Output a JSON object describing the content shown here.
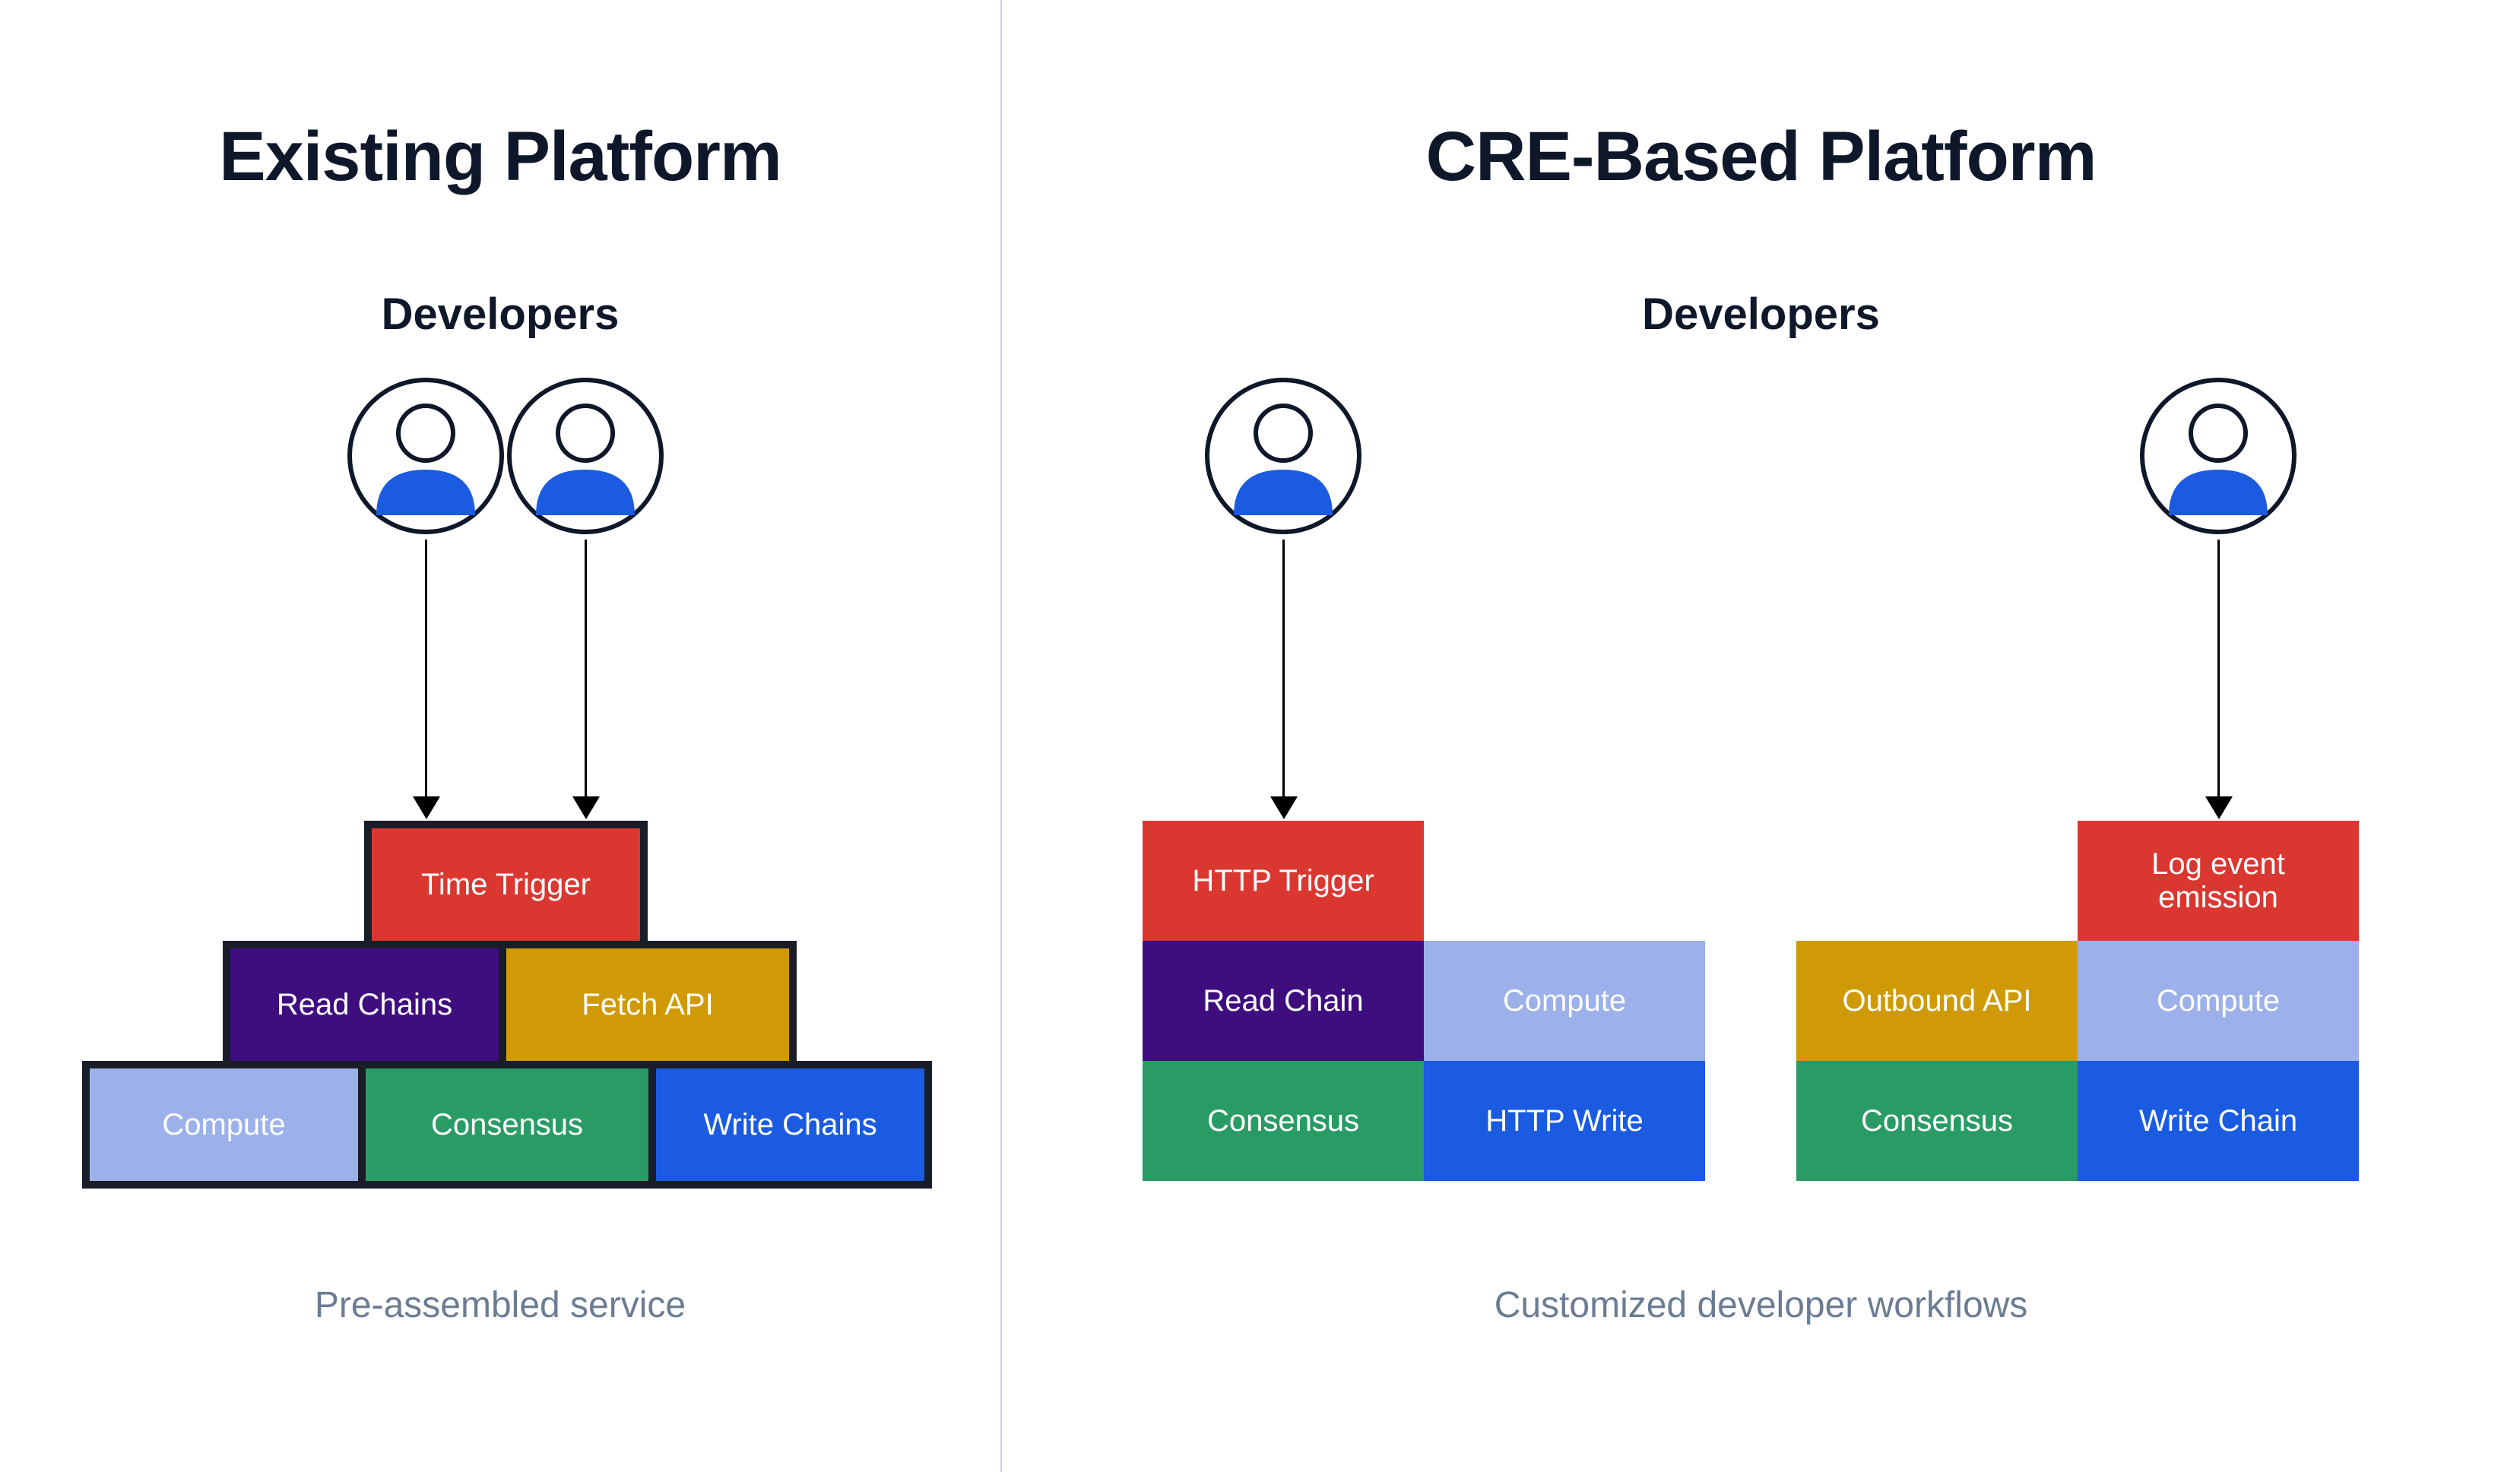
{
  "left": {
    "title": "Existing Platform",
    "subtitle": "Developers",
    "caption": "Pre-assembled service",
    "blocks": {
      "time_trigger": "Time Trigger",
      "read_chains": "Read Chains",
      "fetch_api": "Fetch API",
      "compute": "Compute",
      "consensus": "Consensus",
      "write_chains": "Write Chains"
    }
  },
  "right": {
    "title": "CRE-Based Platform",
    "subtitle": "Developers",
    "caption": "Customized developer workflows",
    "stack_a": {
      "http_trigger": "HTTP Trigger",
      "read_chain": "Read Chain",
      "compute": "Compute",
      "consensus": "Consensus",
      "http_write": "HTTP Write"
    },
    "stack_b": {
      "log_event": "Log event\nemission",
      "outbound_api": "Outbound API",
      "compute": "Compute",
      "consensus": "Consensus",
      "write_chain": "Write Chain"
    }
  },
  "colors": {
    "red": "#DA3731",
    "purple": "#3E0D7E",
    "amber": "#D09A06",
    "lblue": "#9CB0EA",
    "green": "#299B64",
    "blue": "#1A5BE1",
    "text_dark": "#0f172a",
    "text_muted": "#6b7c93",
    "divider": "#cad2e0",
    "border": "#181d27",
    "user_fill": "#1A5BE1"
  }
}
